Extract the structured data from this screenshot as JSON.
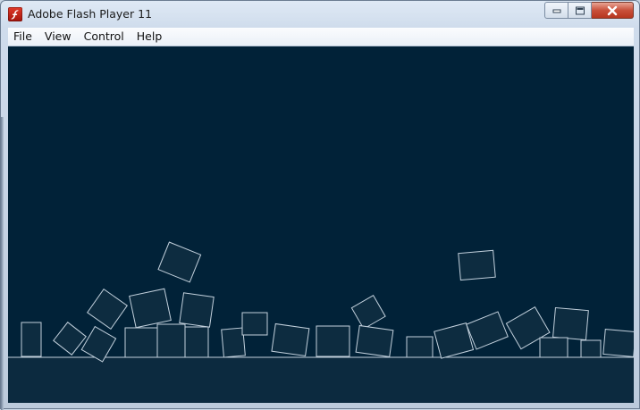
{
  "window": {
    "title": "Adobe Flash Player 11",
    "icon": "flash-player-icon",
    "caption_buttons": [
      "minimize-icon",
      "maximize-icon",
      "close-icon"
    ]
  },
  "menu": {
    "items": [
      "File",
      "View",
      "Control",
      "Help"
    ]
  },
  "stage": {
    "background": "#012238",
    "ground_color": "#0c2a3f",
    "box_fill": "#0d2c40",
    "box_stroke": "#c2d0dc"
  }
}
